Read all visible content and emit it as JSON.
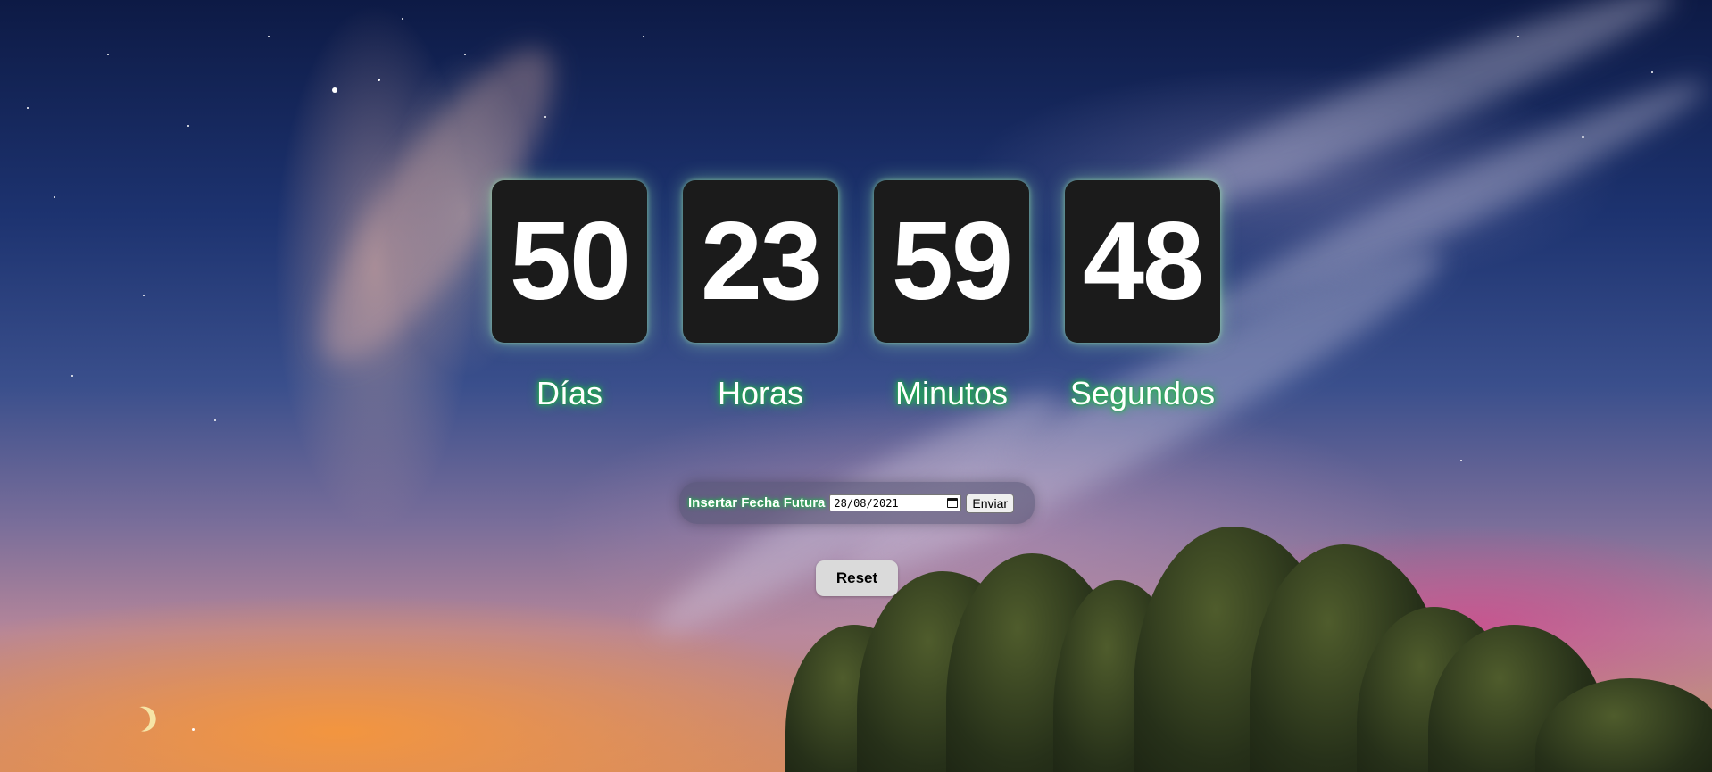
{
  "countdown": {
    "days": "50",
    "hours": "23",
    "minutes": "59",
    "seconds": "48",
    "labels": {
      "days": "Días",
      "hours": "Horas",
      "minutes": "Minutos",
      "seconds": "Segundos"
    }
  },
  "form": {
    "label": "Insertar Fecha Futura",
    "date_value": "28/08/2021",
    "submit_label": "Enviar",
    "calendar_icon": "calendar-icon"
  },
  "reset_label": "Reset",
  "colors": {
    "tile_background": "#1b1b1b",
    "label_glow": "#1fbf4a",
    "reset_background": "#dadada"
  }
}
